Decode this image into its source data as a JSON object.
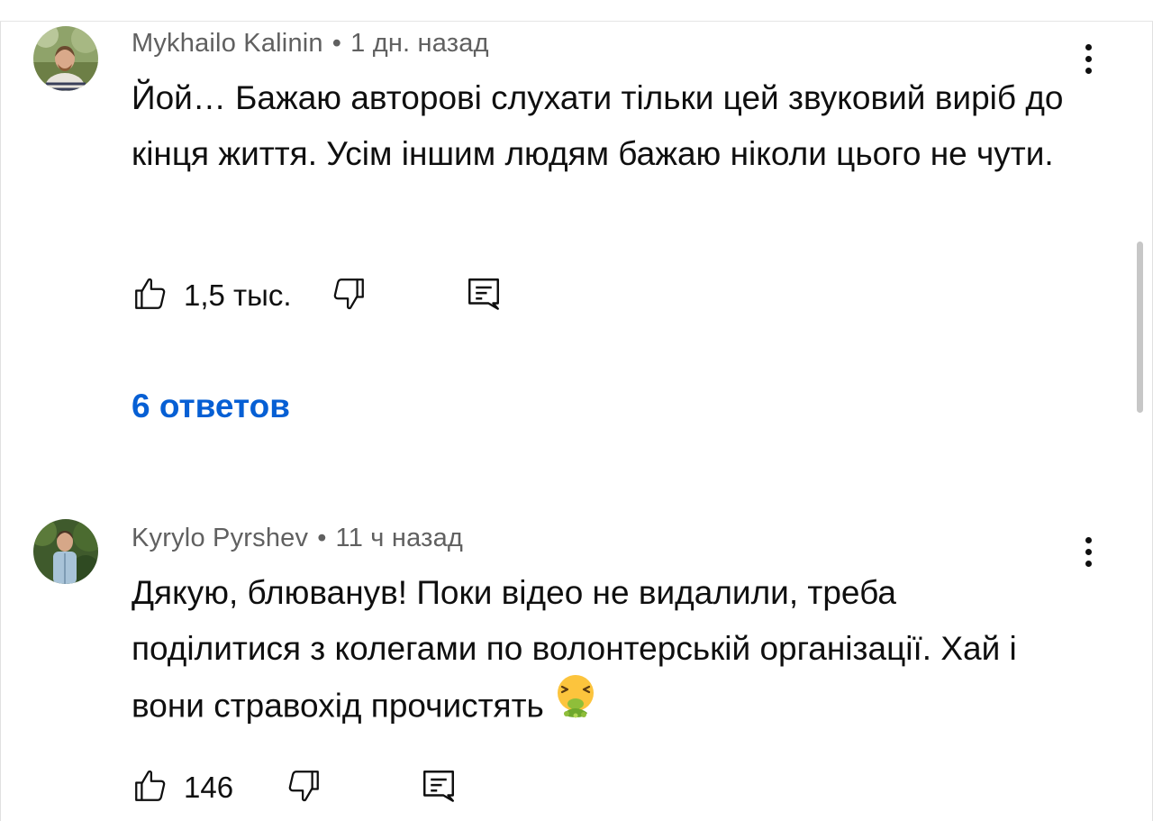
{
  "comments": [
    {
      "author": "Mykhailo Kalinin",
      "time": "1 дн. назад",
      "text": "Йой… Бажаю авторові слухати тільки цей звуковий виріб до кінця життя. Усім іншим людям бажаю ніколи цього не чути.",
      "likes": "1,5 тыс.",
      "replies_label": "6 ответов",
      "icons": {
        "like": "thumbs-up-icon",
        "dislike": "thumbs-down-icon",
        "reply": "reply-comment-icon",
        "more": "more-vertical-icon"
      }
    },
    {
      "author": "Kyrylo Pyrshev",
      "time": "11 ч назад",
      "text": "Дякую, блюванув! Поки відео не видалили, треба поділитися з колегами по волонтерській організації. Хай і вони стравохід прочистять",
      "emoji": "vomiting-face-emoji",
      "likes": "146",
      "icons": {
        "like": "thumbs-up-icon",
        "dislike": "thumbs-down-icon",
        "reply": "reply-comment-icon",
        "more": "more-vertical-icon"
      }
    }
  ],
  "meta_separator": "•",
  "colors": {
    "link": "#065fd4",
    "meta": "#606060",
    "text": "#0f0f0f",
    "scrollbar": "#c7c7c7"
  }
}
